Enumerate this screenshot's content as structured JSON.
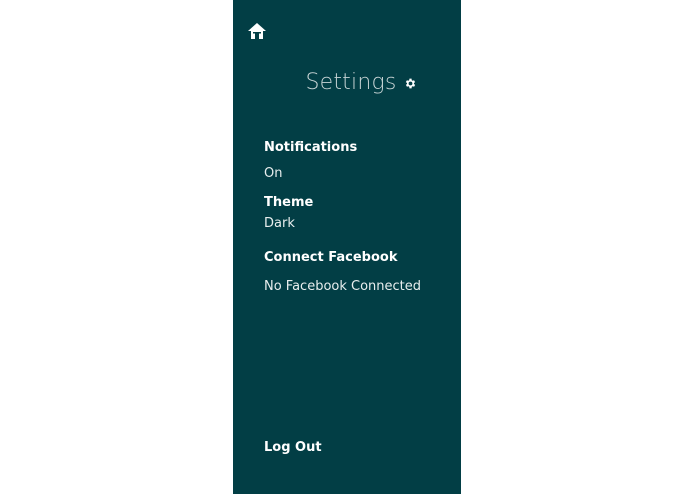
{
  "colors": {
    "panel_background": "#023e45",
    "page_background": "#ffffff",
    "title_text": "#c6d3d4",
    "text": "#ffffff"
  },
  "nav": {
    "home_icon": "home-icon"
  },
  "header": {
    "title": "Settings",
    "icon": "gear-icon"
  },
  "settings": {
    "notifications": {
      "label": "Notifications",
      "value": "On"
    },
    "theme": {
      "label": "Theme",
      "value": "Dark"
    },
    "facebook": {
      "label": "Connect Facebook",
      "value": "No Facebook Connected"
    }
  },
  "footer": {
    "logout_label": "Log Out"
  }
}
